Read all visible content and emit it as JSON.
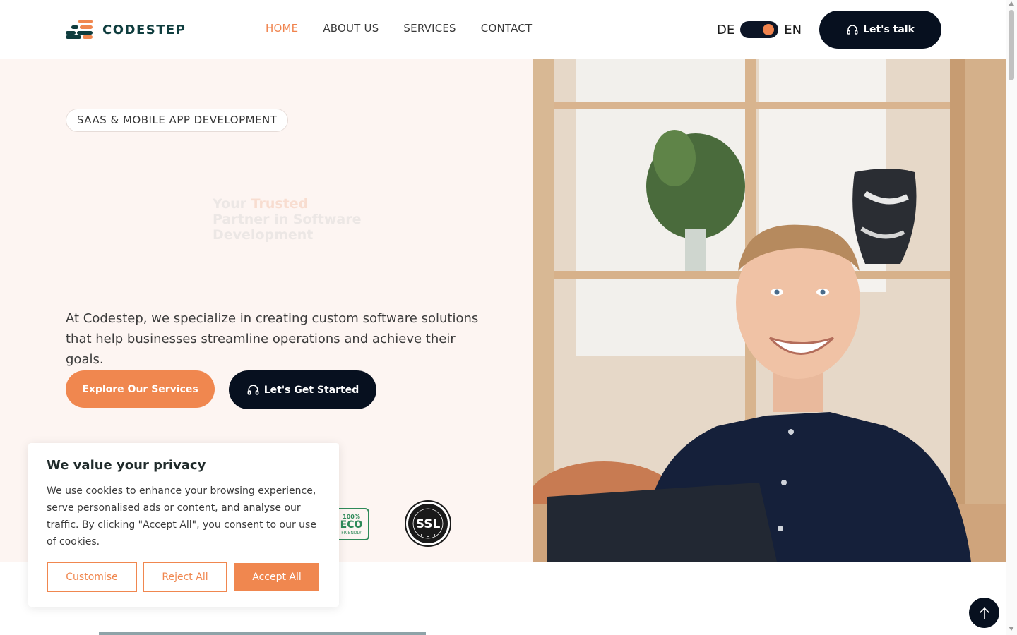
{
  "brand": {
    "name": "CODESTEP"
  },
  "nav": {
    "items": [
      "HOME",
      "ABOUT US",
      "SERVICES",
      "CONTACT"
    ],
    "active": "HOME"
  },
  "language": {
    "left": "DE",
    "right": "EN",
    "selected": "EN"
  },
  "header": {
    "cta_label": "Let's talk"
  },
  "hero": {
    "pill": "SAAS & MOBILE APP DEVELOPMENT",
    "headline_part1": "Your ",
    "headline_accent": "Trusted",
    "headline_part2": "Partner in Software Development",
    "description": "At Codestep, we specialize in creating custom software solutions that help businesses streamline operations and achieve their goals.",
    "primary_cta": "Explore Our Services",
    "secondary_cta": "Let's Get Started",
    "badges": {
      "eco_top": "100%",
      "eco_main": "ECO",
      "eco_bottom": "FRIENDLY",
      "ssl": "SSL"
    }
  },
  "cookie": {
    "title": "We value your privacy",
    "body": "We use cookies to enhance your browsing experience, serve personalised ads or content, and analyse our traffic. By clicking \"Accept All\", you consent to our use of cookies.",
    "customise": "Customise",
    "reject": "Reject All",
    "accept": "Accept All"
  },
  "colors": {
    "accent": "#f0874f",
    "dark": "#07101f",
    "hero_bg": "#fdf5f2",
    "brand_text": "#0f3d3e"
  },
  "icons": {
    "talk": "headset-icon",
    "start": "headset-icon",
    "back_to_top": "arrow-up-icon"
  }
}
